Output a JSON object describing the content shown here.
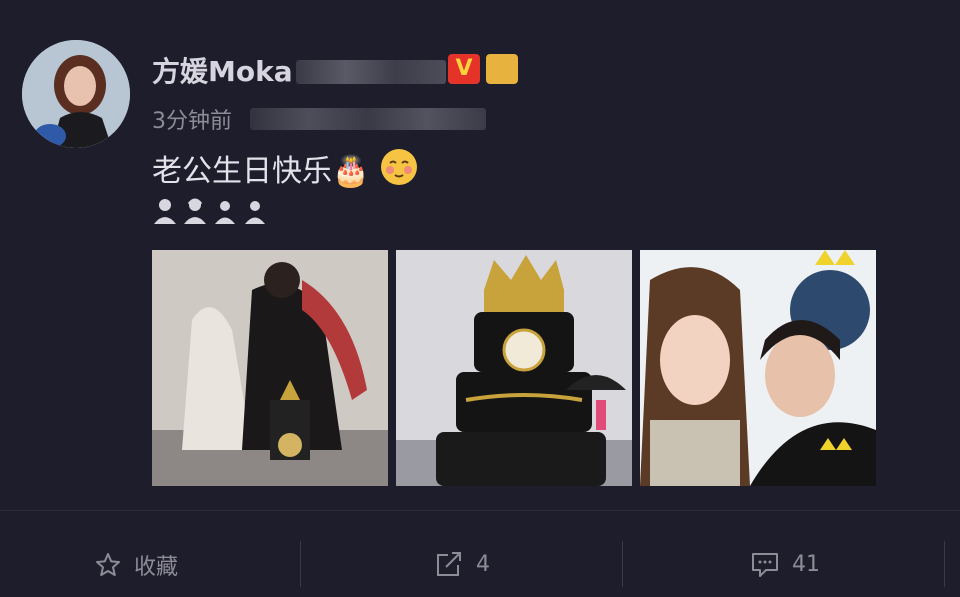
{
  "post": {
    "author": "方媛Moka",
    "time": "3分钟前",
    "text": "老公生日快乐🎂",
    "emoji_icons": [
      "person-icon",
      "person-icon",
      "person-icon",
      "person-icon"
    ]
  },
  "actions": {
    "favorite_label": "收藏",
    "share_count": "4",
    "comment_count": "41"
  },
  "colors": {
    "background": "#1e1d2b",
    "vip_badge": "#e5332a",
    "muted_text": "#8c8b96"
  }
}
